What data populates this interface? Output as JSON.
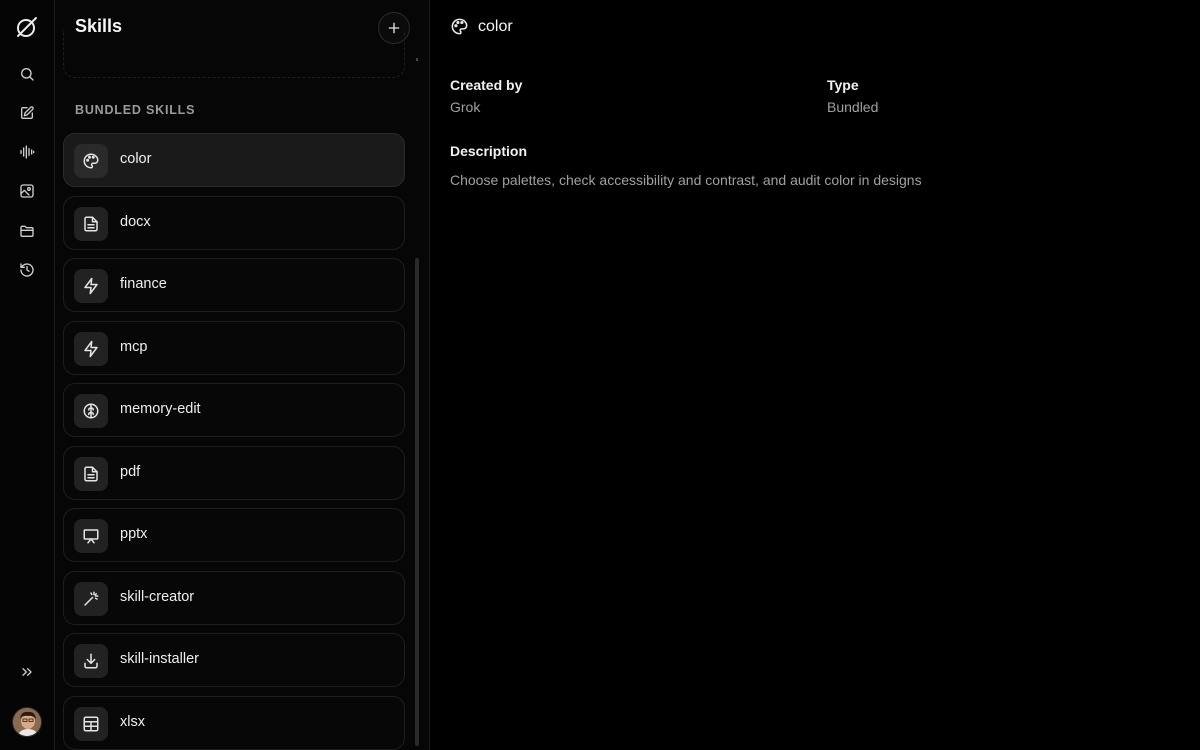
{
  "sidebar": {
    "nav": [
      {
        "icon": "search-icon"
      },
      {
        "icon": "edit-icon"
      },
      {
        "icon": "voice-icon"
      },
      {
        "icon": "image-icon"
      },
      {
        "icon": "folder-icon"
      },
      {
        "icon": "history-icon"
      }
    ],
    "expand_icon": "chevrons-right-icon"
  },
  "panel": {
    "title": "Skills",
    "section_heading": "BUNDLED SKILLS",
    "skills": [
      {
        "name": "color",
        "icon": "palette-icon",
        "active": true
      },
      {
        "name": "docx",
        "icon": "document-icon",
        "active": false
      },
      {
        "name": "finance",
        "icon": "lightning-icon",
        "active": false
      },
      {
        "name": "mcp",
        "icon": "lightning-icon",
        "active": false
      },
      {
        "name": "memory-edit",
        "icon": "brain-icon",
        "active": false
      },
      {
        "name": "pdf",
        "icon": "document-icon",
        "active": false
      },
      {
        "name": "pptx",
        "icon": "presentation-icon",
        "active": false
      },
      {
        "name": "skill-creator",
        "icon": "magic-wand-icon",
        "active": false
      },
      {
        "name": "skill-installer",
        "icon": "download-icon",
        "active": false
      },
      {
        "name": "xlsx",
        "icon": "table-icon",
        "active": false
      }
    ]
  },
  "detail": {
    "title": "color",
    "created_by_label": "Created by",
    "created_by_value": "Grok",
    "type_label": "Type",
    "type_value": "Bundled",
    "description_label": "Description",
    "description_value": "Choose palettes, check accessibility and contrast, and audit color in designs"
  },
  "colors": {
    "background": "#000000",
    "active_item": "#1a1a1a",
    "muted_text": "#a0a0a0"
  }
}
